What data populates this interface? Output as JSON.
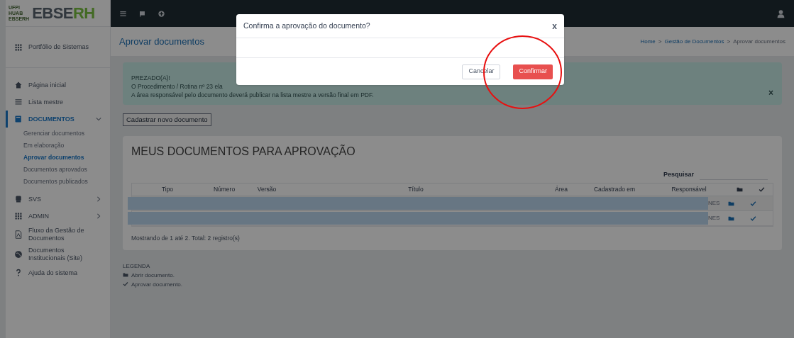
{
  "logo": {
    "small_lines": [
      "UFPI",
      "HUAB",
      "EBSERH"
    ],
    "brand_a": "EBSE",
    "brand_b": "RH"
  },
  "sidebar": {
    "header": "Portfólio de Sistemas",
    "items": [
      {
        "label": "Página inicial",
        "selected": false
      },
      {
        "label": "Lista mestre",
        "selected": false
      },
      {
        "label": "DOCUMENTOS",
        "selected": true,
        "expanded": true,
        "children": [
          {
            "label": "Gerenciar documentos",
            "selected": false
          },
          {
            "label": "Em elaboração",
            "selected": false
          },
          {
            "label": "Aprovar documentos",
            "selected": true
          },
          {
            "label": "Documentos aprovados",
            "selected": false
          },
          {
            "label": "Documentos publicados",
            "selected": false
          }
        ]
      },
      {
        "label": "SVS",
        "selected": false,
        "expanded": false
      },
      {
        "label": "ADMIN",
        "selected": false,
        "expanded": false
      },
      {
        "label": "Fluxo da Gestão de Documentos",
        "selected": false
      },
      {
        "label": "Documentos Institucionais (Site)",
        "selected": false
      },
      {
        "label": "Ajuda do sistema",
        "selected": false
      }
    ]
  },
  "page_title": "Aprovar documentos",
  "breadcrumb": [
    {
      "label": "Home",
      "kind": "link"
    },
    {
      "label": ">",
      "kind": "separator"
    },
    {
      "label": "Gestão de Documentos",
      "kind": "link"
    },
    {
      "label": ">",
      "kind": "separator"
    },
    {
      "label": "Aprovar documentos",
      "kind": "current"
    }
  ],
  "alert": {
    "lines": [
      "PREZADO(A)!",
      "O Procedimento / Rotina nº 23 ela",
      "A área responsável pelo documento deverá publicar na lista mestre a versão final em PDF."
    ],
    "close": "×"
  },
  "new_button": "Cadastrar novo documento",
  "card": {
    "title": "MEUS DOCUMENTOS PARA APROVAÇÃO",
    "search_label": "Pesquisar",
    "columns": [
      "Tipo",
      "Número",
      "Versão",
      "Título",
      "Área",
      "Cadastrado em",
      "Responsável"
    ],
    "rows": [
      {
        "responsavel_tail": "NES"
      },
      {
        "responsavel_tail": "NES"
      }
    ],
    "footer": "Mostrando de 1 até 2. Total: 2 registro(s)"
  },
  "legend": {
    "title": "LEGENDA",
    "items": [
      {
        "label": "Abrir documento."
      },
      {
        "label": "Aprovar documento."
      }
    ]
  },
  "modal": {
    "title": "Confirma a aprovação do documento?",
    "close": "x",
    "buttons": [
      {
        "label": "Cancelar",
        "kind": "secondary"
      },
      {
        "label": "Confirmar",
        "kind": "danger"
      }
    ]
  }
}
